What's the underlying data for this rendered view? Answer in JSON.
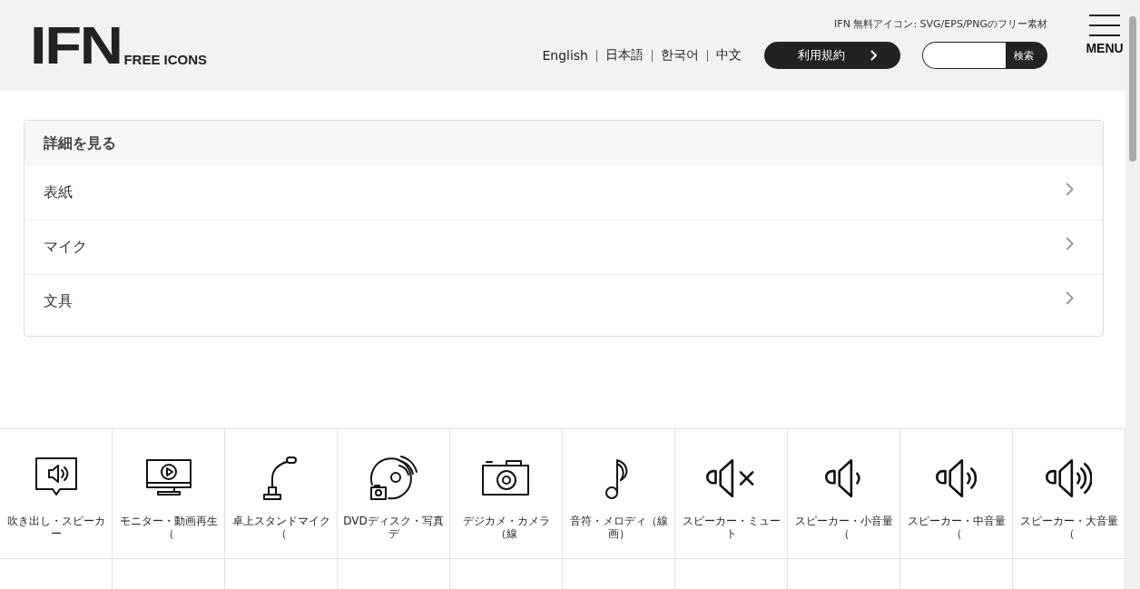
{
  "header": {
    "logo": "IFN",
    "logo_sub": "FREE ICONS",
    "tagline": "IFN 無料アイコン: SVG/EPS/PNGのフリー素材",
    "languages": [
      "English",
      "日本語",
      "한국어",
      "中文"
    ],
    "terms_button": "利用規約",
    "search": {
      "button": "検索"
    },
    "menu": "MENU"
  },
  "details": {
    "title": "詳細を見る",
    "items": [
      "表紙",
      "マイク",
      "文具"
    ]
  },
  "icons": [
    {
      "kind": "speech-speaker",
      "label": "吹き出し・スピーカー"
    },
    {
      "kind": "monitor-play",
      "label": "モニター・動画再生（"
    },
    {
      "kind": "desk-mic",
      "label": "卓上スタンドマイク（"
    },
    {
      "kind": "disc-camera",
      "label": "DVDディスク・写真デ"
    },
    {
      "kind": "camera",
      "label": "デジカメ・カメラ（線"
    },
    {
      "kind": "note",
      "label": "音符・メロディ（線画）"
    },
    {
      "kind": "speaker-mute",
      "label": "スピーカー・ミュート"
    },
    {
      "kind": "speaker-1",
      "label": "スピーカー・小音量（"
    },
    {
      "kind": "speaker-2",
      "label": "スピーカー・中音量（"
    },
    {
      "kind": "speaker-3",
      "label": "スピーカー・大音量（"
    }
  ]
}
